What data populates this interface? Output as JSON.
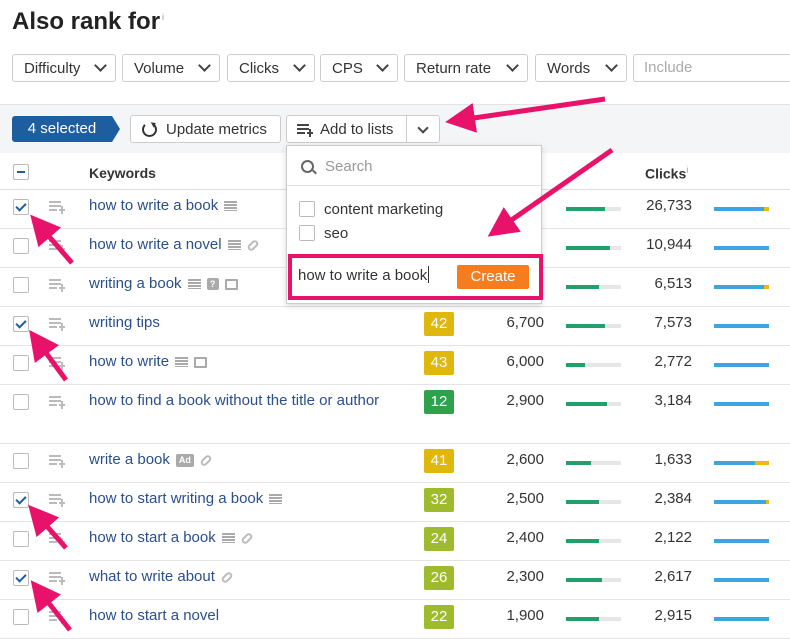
{
  "title": "Also rank for",
  "title_info": "i",
  "filters": [
    "Difficulty",
    "Volume",
    "Clicks",
    "CPS",
    "Return rate",
    "Words"
  ],
  "include_placeholder": "Include",
  "toolbar": {
    "selected_label": "4 selected",
    "update_label": "Update metrics",
    "add_label": "Add to lists"
  },
  "columns": {
    "keywords": "Keywords",
    "clicks": "Clicks",
    "clicks_info": "i"
  },
  "dropdown": {
    "search_placeholder": "Search",
    "lists": [
      "content marketing",
      "seo"
    ],
    "new_list_value": "how to write a book",
    "create_label": "Create"
  },
  "rows": [
    {
      "keyword": "how to write a book",
      "checked": true,
      "icons": [
        "serp"
      ],
      "kd": "",
      "volume": "",
      "traffic": 0.7,
      "clicks": "26,733",
      "paid": 0.1
    },
    {
      "keyword": "how to write a novel",
      "checked": false,
      "icons": [
        "serp",
        "link"
      ],
      "kd": "",
      "volume": "",
      "traffic": 0.8,
      "clicks": "10,944",
      "paid": 0.0
    },
    {
      "keyword": "writing a book",
      "checked": false,
      "icons": [
        "serp",
        "question",
        "image"
      ],
      "kd": "",
      "volume": "",
      "traffic": 0.6,
      "clicks": "6,513",
      "paid": 0.1
    },
    {
      "keyword": "writing tips",
      "checked": true,
      "icons": [],
      "kd": "42",
      "volume": "6,700",
      "traffic": 0.7,
      "clicks": "7,573",
      "paid": 0.0
    },
    {
      "keyword": "how to write",
      "checked": false,
      "icons": [
        "serp",
        "image"
      ],
      "kd": "43",
      "volume": "6,000",
      "traffic": 0.35,
      "clicks": "2,772",
      "paid": 0.0
    },
    {
      "keyword": "how to find a book without the title or author",
      "checked": false,
      "icons": [],
      "kd": "12",
      "volume": "2,900",
      "traffic": 0.75,
      "clicks": "3,184",
      "paid": 0.0
    },
    {
      "keyword": "write a book",
      "checked": false,
      "icons": [
        "ad",
        "link"
      ],
      "kd": "41",
      "volume": "2,600",
      "traffic": 0.45,
      "clicks": "1,633",
      "paid": 0.25
    },
    {
      "keyword": "how to start writing a book",
      "checked": true,
      "icons": [
        "serp"
      ],
      "kd": "32",
      "volume": "2,500",
      "traffic": 0.6,
      "clicks": "2,384",
      "paid": 0.05
    },
    {
      "keyword": "how to start a book",
      "checked": false,
      "icons": [
        "serp",
        "link"
      ],
      "kd": "24",
      "volume": "2,400",
      "traffic": 0.6,
      "clicks": "2,122",
      "paid": 0.0
    },
    {
      "keyword": "what to write about",
      "checked": true,
      "icons": [
        "link"
      ],
      "kd": "26",
      "volume": "2,300",
      "traffic": 0.65,
      "clicks": "2,617",
      "paid": 0.0
    },
    {
      "keyword": "how to start a novel",
      "checked": false,
      "icons": [],
      "kd": "22",
      "volume": "1,900",
      "traffic": 0.6,
      "clicks": "2,915",
      "paid": 0.0
    }
  ],
  "colors": {
    "accent": "#1f5e9e",
    "link": "#2a4f8c",
    "highlight": "#e8126a",
    "create": "#f47d20"
  }
}
